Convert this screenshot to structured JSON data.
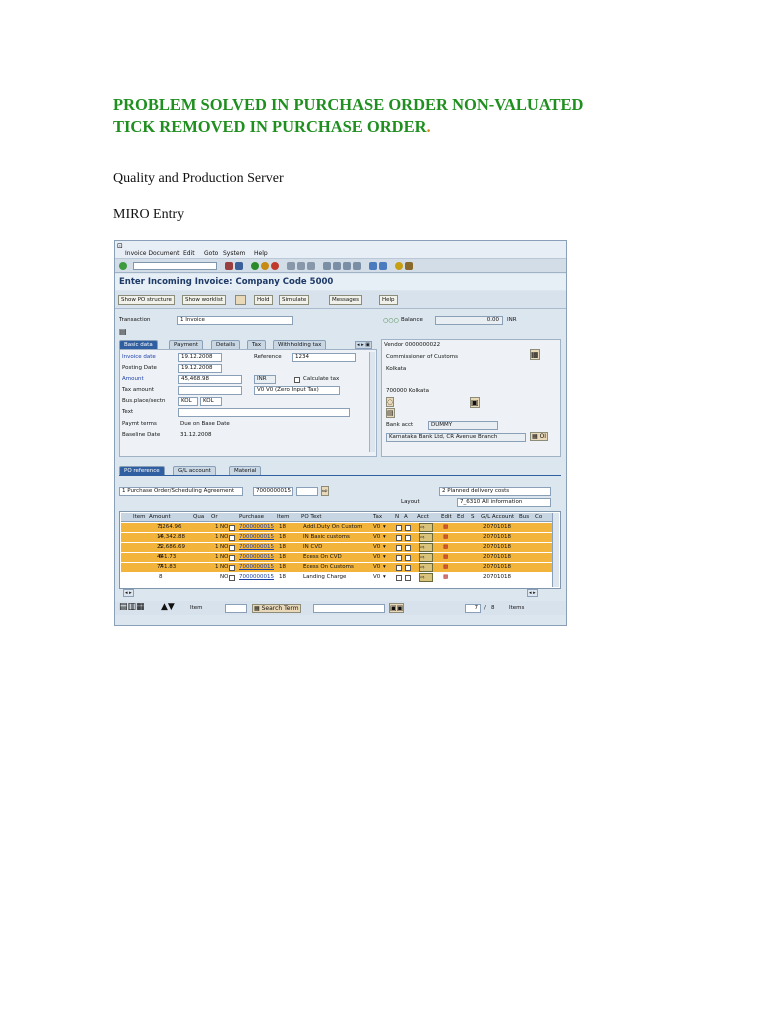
{
  "doc": {
    "heading_line1": "PROBLEM SOLVED IN PURCHASE ORDER NON-VALUATED",
    "heading_line2": "TICK REMOVED IN PURCHASE ORDER",
    "heading_dot": ".",
    "para1": "Quality and Production Server",
    "para2": "MIRO Entry"
  },
  "sap": {
    "menu": [
      "Invoice Document",
      "Edit",
      "Goto",
      "System",
      "Help"
    ],
    "title": "Enter Incoming Invoice: Company Code 5000",
    "buttons": [
      "Show PO structure",
      "Show worklist",
      "Hold",
      "Simulate",
      "Messages",
      "Help"
    ],
    "transaction_label": "Transaction",
    "transaction_value": "1 Invoice",
    "balance_label": "Balance",
    "balance_value": "0.00",
    "balance_currency": "INR",
    "tabs": [
      "Basic data",
      "Payment",
      "Details",
      "Tax",
      "Withholding tax"
    ],
    "fields": {
      "invoice_date_label": "Invoice date",
      "invoice_date": "19.12.2008",
      "posting_date_label": "Posting Date",
      "posting_date": "19.12.2008",
      "amount_label": "Amount",
      "amount": "45,468.98",
      "currency": "INR",
      "calculate_tax": "Calculate tax",
      "tax_amount_label": "Tax amount",
      "tax_code": "V0 V0 (Zero Input Tax)",
      "bus_place_label": "Bus.place/sectn",
      "bus_place1": "KOL",
      "bus_place2": "KOL",
      "text_label": "Text",
      "paymt_terms_label": "Paymt terms",
      "paymt_terms": "Due on Base Date",
      "baseline_label": "Baseline Date",
      "baseline": "31.12.2008",
      "reference_label": "Reference",
      "reference": "1234"
    },
    "vendor": {
      "header": "Vendor 0000000022",
      "name": "Commissioner of Customs",
      "city": "Kolkata",
      "postal": "700000 Kolkata",
      "bank_acct_label": "Bank acct",
      "bank_acct": "DUMMY",
      "bank": "Karnataka Bank Ltd, CR Avenue Branch",
      "oi_label": "OI"
    },
    "lower_tabs": [
      "PO reference",
      "G/L account",
      "Material"
    ],
    "po_ref_type": "1 Purchase Order/Scheduling Agreement",
    "po_number": "7000000015",
    "delivery": "2 Planned delivery costs",
    "layout_label": "Layout",
    "layout_value": "7_6310 All information",
    "columns": [
      "Item",
      "Amount",
      "Qua",
      "Or",
      "",
      "Purchase",
      "Item",
      "PO Text",
      "Tax",
      "N",
      "A",
      "Acct",
      "Edit",
      "Ed",
      "S",
      "G/L Account",
      "Bus",
      "Co"
    ],
    "rows": [
      {
        "item": "3",
        "amount": "7,264.96",
        "qty": "1",
        "ord": "NO",
        "po": "7000000015",
        "poitem": "18",
        "text": "Addl.Duty On Custom",
        "tax": "V0",
        "gl": "20701018",
        "highlight": true
      },
      {
        "item": "4",
        "amount": "14,342.88",
        "qty": "1",
        "ord": "NO",
        "po": "7000000015",
        "poitem": "18",
        "text": "IN Basic customs",
        "tax": "V0",
        "gl": "20701018",
        "highlight": true
      },
      {
        "item": "5",
        "amount": "22,686.69",
        "qty": "1",
        "ord": "NO",
        "po": "7000000015",
        "poitem": "18",
        "text": "IN CVD",
        "tax": "V0",
        "gl": "20701018",
        "highlight": true
      },
      {
        "item": "6",
        "amount": "441.73",
        "qty": "1",
        "ord": "NO",
        "po": "7000000015",
        "poitem": "18",
        "text": "Ecess On CVD",
        "tax": "V0",
        "gl": "20701018",
        "highlight": true
      },
      {
        "item": "7",
        "amount": "741.83",
        "qty": "1",
        "ord": "NO",
        "po": "7000000015",
        "poitem": "18",
        "text": "Ecess On Customs",
        "tax": "V0",
        "gl": "20701018",
        "highlight": true
      },
      {
        "item": "8",
        "amount": "",
        "qty": "",
        "ord": "NO",
        "po": "7000000015",
        "poitem": "18",
        "text": "Landing Charge",
        "tax": "V0",
        "gl": "20701018",
        "highlight": false
      }
    ],
    "bottom": {
      "item_label": "Item",
      "search_term_label": "Search Term",
      "page_current": "7",
      "page_sep": "/",
      "page_total": "8",
      "items_label": "Items"
    }
  }
}
